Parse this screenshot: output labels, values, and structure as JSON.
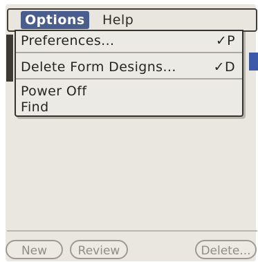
{
  "menubar": {
    "options_label": "Options",
    "help_label": "Help"
  },
  "dropdown": {
    "items": [
      {
        "label": "Preferences...",
        "shortcut": "✓P"
      },
      {
        "label": "Delete Form Designs...",
        "shortcut": "✓D"
      },
      {
        "label": "Power Off",
        "shortcut": ""
      },
      {
        "label": "Find",
        "shortcut": ""
      }
    ]
  },
  "buttons": {
    "new_label": "New",
    "review_label": "Review",
    "delete_label": "Delete..."
  }
}
